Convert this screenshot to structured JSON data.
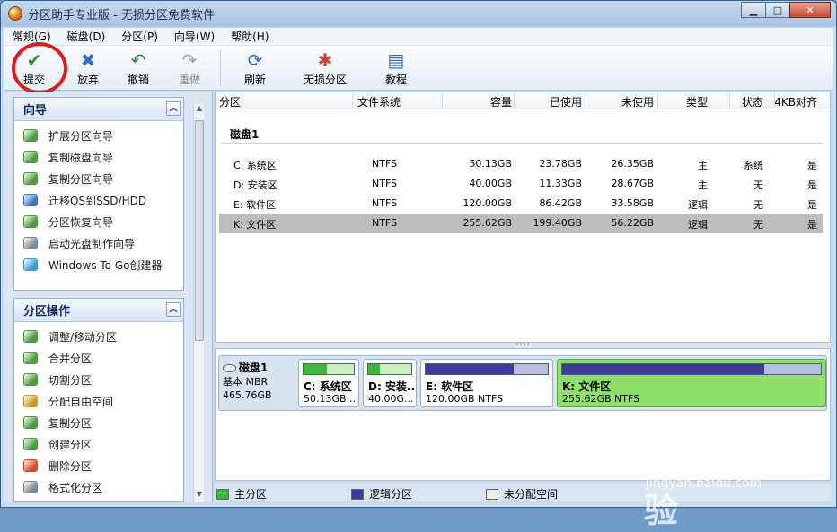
{
  "window": {
    "title": "分区助手专业版 - 无损分区免费软件"
  },
  "window_controls": {
    "minimize": "▁",
    "maximize": "□",
    "close": "✕"
  },
  "menu": [
    "常规(G)",
    "磁盘(D)",
    "分区(P)",
    "向导(W)",
    "帮助(H)"
  ],
  "toolbar": [
    {
      "label": "提交",
      "icon": "check-icon",
      "glyph": "✔",
      "color": "#2f8f2f",
      "enabled": true
    },
    {
      "label": "放弃",
      "icon": "discard-icon",
      "glyph": "✖",
      "color": "#2f6fc4",
      "enabled": true
    },
    {
      "label": "撤销",
      "icon": "undo-icon",
      "glyph": "↶",
      "color": "#2a8a3a",
      "enabled": true
    },
    {
      "label": "重做",
      "icon": "redo-icon",
      "glyph": "↷",
      "color": "#9aa3ad",
      "enabled": false
    },
    {
      "label": "刷新",
      "icon": "refresh-icon",
      "glyph": "⟳",
      "color": "#2f6fc4",
      "enabled": true
    },
    {
      "label": "无损分区",
      "icon": "lossless-partition-icon",
      "glyph": "✱",
      "color": "#c9422a",
      "enabled": true
    },
    {
      "label": "教程",
      "icon": "tutorial-icon",
      "glyph": "▤",
      "color": "#2f6fc4",
      "enabled": true
    }
  ],
  "wizard_panel": {
    "title": "向导",
    "collapse": "︽",
    "items": [
      {
        "label": "扩展分区向导",
        "icon": "extend-partition-icon",
        "color": "#4a9a3a"
      },
      {
        "label": "复制磁盘向导",
        "icon": "copy-disk-icon",
        "color": "#4a9a3a"
      },
      {
        "label": "复制分区向导",
        "icon": "copy-partition-icon",
        "color": "#4a9a3a"
      },
      {
        "label": "迁移OS到SSD/HDD",
        "icon": "migrate-os-icon",
        "color": "#3a78c4"
      },
      {
        "label": "分区恢复向导",
        "icon": "partition-recovery-icon",
        "color": "#4a9a3a"
      },
      {
        "label": "启动光盘制作向导",
        "icon": "bootable-cd-icon",
        "color": "#7c8797"
      },
      {
        "label": "Windows To Go创建器",
        "icon": "windows-logo-icon",
        "color": "#3a9ad9"
      }
    ]
  },
  "operations_panel": {
    "title": "分区操作",
    "collapse": "︽",
    "items": [
      {
        "label": "调整/移动分区",
        "icon": "resize-move-icon",
        "color": "#4a9a3a"
      },
      {
        "label": "合并分区",
        "icon": "merge-icon",
        "color": "#4a9a3a"
      },
      {
        "label": "切割分区",
        "icon": "split-icon",
        "color": "#4a9a3a"
      },
      {
        "label": "分配自由空间",
        "icon": "allocate-space-icon",
        "color": "#c99a2a"
      },
      {
        "label": "复制分区",
        "icon": "copy-icon",
        "color": "#4a9a3a"
      },
      {
        "label": "创建分区",
        "icon": "create-icon",
        "color": "#4a9a3a"
      },
      {
        "label": "删除分区",
        "icon": "delete-icon",
        "color": "#d9482a"
      },
      {
        "label": "格式化分区",
        "icon": "format-icon",
        "color": "#7c8797"
      }
    ]
  },
  "grid": {
    "columns": [
      "分区",
      "文件系统",
      "容量",
      "已使用",
      "未使用",
      "类型",
      "状态",
      "4KB对齐"
    ],
    "disk_label": "磁盘1",
    "rows": [
      {
        "partition": "C: 系统区",
        "fs": "NTFS",
        "capacity": "50.13GB",
        "used": "23.78GB",
        "free": "26.35GB",
        "type": "主",
        "status": "系统",
        "aligned": "是",
        "selected": false
      },
      {
        "partition": "D: 安装区",
        "fs": "NTFS",
        "capacity": "40.00GB",
        "used": "11.33GB",
        "free": "28.67GB",
        "type": "主",
        "status": "无",
        "aligned": "是",
        "selected": false
      },
      {
        "partition": "E: 软件区",
        "fs": "NTFS",
        "capacity": "120.00GB",
        "used": "86.42GB",
        "free": "33.58GB",
        "type": "逻辑",
        "status": "无",
        "aligned": "是",
        "selected": false
      },
      {
        "partition": "K: 文件区",
        "fs": "NTFS",
        "capacity": "255.62GB",
        "used": "199.40GB",
        "free": "56.22GB",
        "type": "逻辑",
        "status": "无",
        "aligned": "是",
        "selected": true
      }
    ]
  },
  "splitter": "••••",
  "disk_map": {
    "name": "磁盘1",
    "type": "基本 MBR",
    "size": "465.76GB",
    "partitions": [
      {
        "name": "C: 系统区",
        "detail": "50.13GB ...",
        "used_fraction": 0.47,
        "kind": "primary",
        "selected": false
      },
      {
        "name": "D: 安装...",
        "detail": "40.00G...",
        "used_fraction": 0.28,
        "kind": "primary",
        "selected": false
      },
      {
        "name": "E: 软件区",
        "detail": "120.00GB NTFS",
        "used_fraction": 0.72,
        "kind": "logical",
        "selected": false
      },
      {
        "name": "K: 文件区",
        "detail": "255.62GB NTFS",
        "used_fraction": 0.78,
        "kind": "logical",
        "selected": true
      }
    ]
  },
  "legend": [
    {
      "label": "主分区",
      "color": "#3cb83c"
    },
    {
      "label": "逻辑分区",
      "color": "#3a3aa0"
    },
    {
      "label": "未分配空间",
      "color": "#f2efe6"
    }
  ],
  "colors": {
    "primary_fill": "#3cb83c",
    "logical_fill": "#3d3a9c",
    "selected_block": "#8ee06a",
    "annotation": "#e11b1b"
  },
  "watermark": {
    "logo": "Baidu经验",
    "url": "jingyan.baidu.com"
  }
}
